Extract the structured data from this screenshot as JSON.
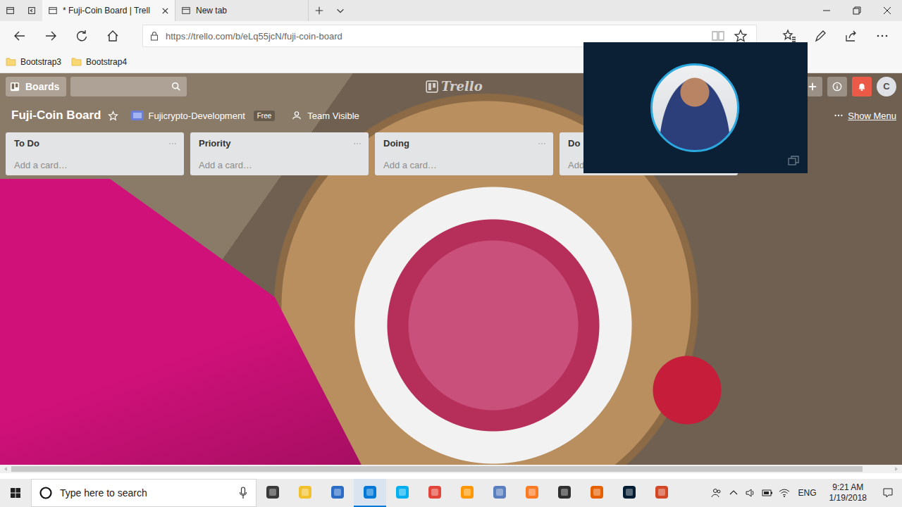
{
  "browser": {
    "tabs": [
      {
        "title": "* Fuji-Coin Board | Trell",
        "selected": true
      },
      {
        "title": "New tab",
        "selected": false
      }
    ],
    "address": "https://trello.com/b/eLq55jcN/fuji-coin-board",
    "favorites": [
      "Bootstrap3",
      "Bootstrap4"
    ]
  },
  "trello": {
    "boards_button": "Boards",
    "logo": "Trello",
    "avatar": "C",
    "notifications_active": true,
    "board": {
      "title": "Fuji-Coin Board",
      "starred": false,
      "team": "Fujicrypto-Development",
      "plan": "Free",
      "visibility": "Team Visible",
      "menu": "Show Menu"
    },
    "lists": [
      {
        "name": "To Do",
        "add": "Add a card…"
      },
      {
        "name": "Priority",
        "add": "Add a card…"
      },
      {
        "name": "Doing",
        "add": "Add a card…"
      },
      {
        "name": "Do",
        "add": "Add"
      }
    ]
  },
  "taskbar": {
    "search": {
      "placeholder": "Type here to search"
    },
    "apps": [
      {
        "color": "#3a3a3a",
        "selected": false
      },
      {
        "color": "#f2c12e",
        "selected": false
      },
      {
        "color": "#2b6cc4",
        "selected": false
      },
      {
        "color": "#0078d7",
        "selected": true
      },
      {
        "color": "#00aff0",
        "selected": false
      },
      {
        "color": "#e2463a",
        "selected": false
      },
      {
        "color": "#ff9800",
        "selected": false
      },
      {
        "color": "#5a7fbf",
        "selected": false
      },
      {
        "color": "#fb7a24",
        "selected": false
      },
      {
        "color": "#2f2f2f",
        "selected": false
      },
      {
        "color": "#e66000",
        "selected": false
      },
      {
        "color": "#001d34",
        "selected": false
      },
      {
        "color": "#d24726",
        "selected": false
      }
    ],
    "language": "ENG",
    "time": "9:21 AM",
    "date": "1/19/2018"
  }
}
